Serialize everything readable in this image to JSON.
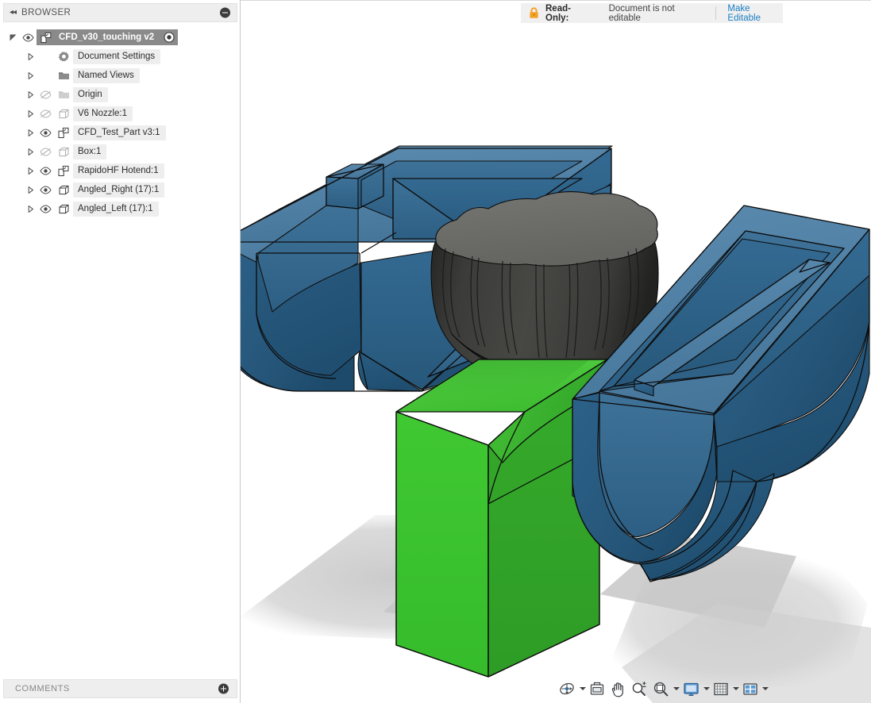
{
  "browser": {
    "panel_title": "BROWSER",
    "collapse_icon": "double-left-chevron-icon",
    "minimize_icon": "minus-circle-icon",
    "root": {
      "label": "CFD_v30_touching v2",
      "icon": "assembly-icon",
      "visibility_icon": "eye-visible-icon",
      "radio_icon": "activate-radio-icon",
      "expanded": true
    },
    "items": [
      {
        "label": "Document Settings",
        "icon": "gear-icon",
        "has_eye": false,
        "visible": true,
        "expand_icon": "chevron-right-icon"
      },
      {
        "label": "Named Views",
        "icon": "folder-icon",
        "has_eye": false,
        "visible": true,
        "expand_icon": "chevron-right-icon"
      },
      {
        "label": "Origin",
        "icon": "folder-icon",
        "has_eye": true,
        "visible": false,
        "expand_icon": "chevron-right-icon"
      },
      {
        "label": "V6 Nozzle:1",
        "icon": "body-cube-icon",
        "has_eye": true,
        "visible": false,
        "expand_icon": "chevron-right-icon"
      },
      {
        "label": "CFD_Test_Part v3:1",
        "icon": "assembly-icon",
        "has_eye": true,
        "visible": true,
        "expand_icon": "chevron-right-icon"
      },
      {
        "label": "Box:1",
        "icon": "body-cube-icon",
        "has_eye": true,
        "visible": false,
        "expand_icon": "chevron-right-icon"
      },
      {
        "label": "RapidoHF Hotend:1",
        "icon": "assembly-icon",
        "has_eye": true,
        "visible": true,
        "expand_icon": "chevron-right-icon"
      },
      {
        "label": "Angled_Right (17):1",
        "icon": "body-cube-icon",
        "has_eye": true,
        "visible": true,
        "expand_icon": "chevron-right-icon"
      },
      {
        "label": "Angled_Left (17):1",
        "icon": "body-cube-icon",
        "has_eye": true,
        "visible": true,
        "expand_icon": "chevron-right-icon"
      }
    ]
  },
  "comments": {
    "label": "COMMENTS",
    "add_icon": "plus-circle-icon"
  },
  "banner": {
    "lock_icon": "lock-closed-icon",
    "lock_color": "#f5a125",
    "read_only_label": "Read-Only:",
    "status_text": "Document is not editable",
    "action_label": "Make Editable",
    "action_color": "#1b7fc4"
  },
  "nav_toolbar": {
    "buttons": [
      {
        "name": "orbit-button",
        "icon": "orbit-icon",
        "caret": true
      },
      {
        "name": "look-at-button",
        "icon": "look-at-icon",
        "caret": false
      },
      {
        "name": "pan-button",
        "icon": "pan-hand-icon",
        "caret": false
      },
      {
        "name": "zoom-button",
        "icon": "zoom-plusminus-icon",
        "caret": false
      },
      {
        "name": "zoom-window-button",
        "icon": "zoom-window-icon",
        "caret": true
      },
      {
        "name": "display-settings-button",
        "icon": "monitor-icon",
        "caret": true
      },
      {
        "name": "grid-snap-button",
        "icon": "grid-icon",
        "caret": true
      },
      {
        "name": "viewports-button",
        "icon": "viewports-icon",
        "caret": true
      }
    ]
  },
  "scene": {
    "title": "CFD_v30_touching v2 assembly exploded view",
    "background": "#ffffff",
    "parts": [
      {
        "name": "Angled_Left (17):1",
        "color_top": "#4d7ea3",
        "color_side": "#2e5d82",
        "color_dark": "#245271"
      },
      {
        "name": "Angled_Right (17):1",
        "color_top": "#4d7ea3",
        "color_side": "#2e5d82",
        "color_dark": "#245271"
      },
      {
        "name": "RapidoHF Hotend:1",
        "color_top": "#6e6e6b",
        "color_side": "#3a3a38",
        "color_dark": "#2a2a28"
      },
      {
        "name": "CFD_Test_Part v3:1",
        "color_top": "#4ecb3c",
        "color_side": "#3cc52e",
        "color_dark": "#32a62a"
      }
    ],
    "shadow_color": "#c9c9c9"
  }
}
